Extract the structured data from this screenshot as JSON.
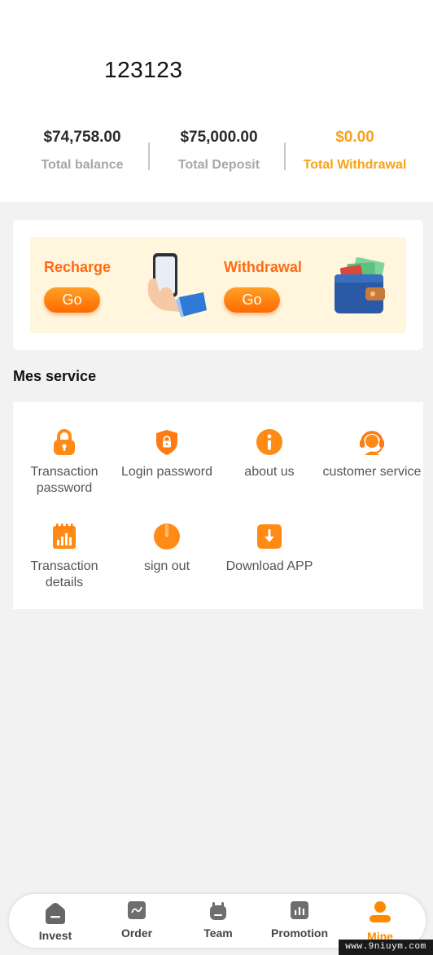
{
  "user": {
    "name": "123123"
  },
  "stats": [
    {
      "amount": "$74,758.00",
      "label": "Total balance"
    },
    {
      "amount": "$75,000.00",
      "label": "Total Deposit"
    },
    {
      "amount": "$0.00",
      "label": "Total Withdrawal"
    }
  ],
  "actions": {
    "recharge": {
      "title": "Recharge",
      "button": "Go",
      "icon": "phone-hand-icon"
    },
    "withdrawal": {
      "title": "Withdrawal",
      "button": "Go",
      "icon": "wallet-icon"
    }
  },
  "services": {
    "title": "Mes service",
    "items": [
      {
        "label": "Transaction password",
        "icon": "lock-icon"
      },
      {
        "label": "Login password",
        "icon": "shield-lock-icon"
      },
      {
        "label": "about us",
        "icon": "info-icon"
      },
      {
        "label": "customer service",
        "icon": "headset-icon"
      },
      {
        "label": "Transaction details",
        "icon": "notebook-chart-icon"
      },
      {
        "label": "sign out",
        "icon": "power-icon"
      },
      {
        "label": "Download APP",
        "icon": "download-icon"
      }
    ]
  },
  "nav": {
    "items": [
      {
        "label": "Invest",
        "icon": "house-icon"
      },
      {
        "label": "Order",
        "icon": "order-chart-icon"
      },
      {
        "label": "Team",
        "icon": "team-icon"
      },
      {
        "label": "Promotion",
        "icon": "bar-chart-icon"
      },
      {
        "label": "Mine",
        "icon": "user-icon"
      }
    ],
    "active": "Mine"
  },
  "watermark": "www.9niuym.com",
  "colors": {
    "accent": "#ff6a13",
    "withdrawal_stat": "#f7a21a",
    "card_bg": "#fff6dd",
    "page_bg": "#f2f2f2"
  }
}
